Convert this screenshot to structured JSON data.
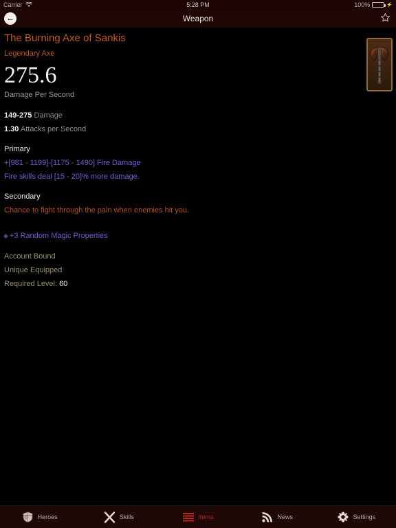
{
  "status_bar": {
    "carrier": "Carrier",
    "wifi_icon": "wifi-icon",
    "time": "5:28 PM",
    "battery_percent": "100%",
    "battery_icon": "battery-icon",
    "charging_icon": "plug-icon"
  },
  "navbar": {
    "title": "Weapon",
    "back_icon": "arrow-left-icon",
    "favorite_icon": "star-outline-icon"
  },
  "item": {
    "name": "The Burning Axe of Sankis",
    "type": "Legendary Axe",
    "dps": "275.6",
    "dps_label": "Damage Per Second",
    "damage_value": "149-275",
    "damage_label": "Damage",
    "speed_value": "1.30",
    "speed_label": "Attacks per Second",
    "primary_heading": "Primary",
    "primary_affixes": [
      "+[981 - 1199]-[1175 - 1490] Fire Damage",
      "Fire skills deal [15 - 20]% more damage."
    ],
    "secondary_heading": "Secondary",
    "secondary_affixes": [
      "Chance to fight through the pain when enemies hit you."
    ],
    "magic_properties": "+3 Random Magic Properties",
    "magic_bullet_icon": "gem-icon",
    "icon_name": "axe-item-icon",
    "meta": [
      {
        "label": "Account Bound",
        "value": ""
      },
      {
        "label": "Unique Equipped",
        "value": ""
      },
      {
        "label": "Required Level: ",
        "value": "60"
      }
    ]
  },
  "tabbar": {
    "tabs": [
      {
        "label": "Heroes",
        "icon": "shield-icon",
        "active": false
      },
      {
        "label": "Skills",
        "icon": "swords-icon",
        "active": false
      },
      {
        "label": "Items",
        "icon": "list-icon",
        "active": true
      },
      {
        "label": "News",
        "icon": "rss-icon",
        "active": false
      },
      {
        "label": "Settings",
        "icon": "gear-icon",
        "active": false
      }
    ]
  },
  "colors": {
    "legendary": "#c1582a",
    "affix_blue": "#6a63cc",
    "accent_red": "#bb2a22",
    "meta_tan": "#9a8d73",
    "navbar_bg": "#200705"
  }
}
